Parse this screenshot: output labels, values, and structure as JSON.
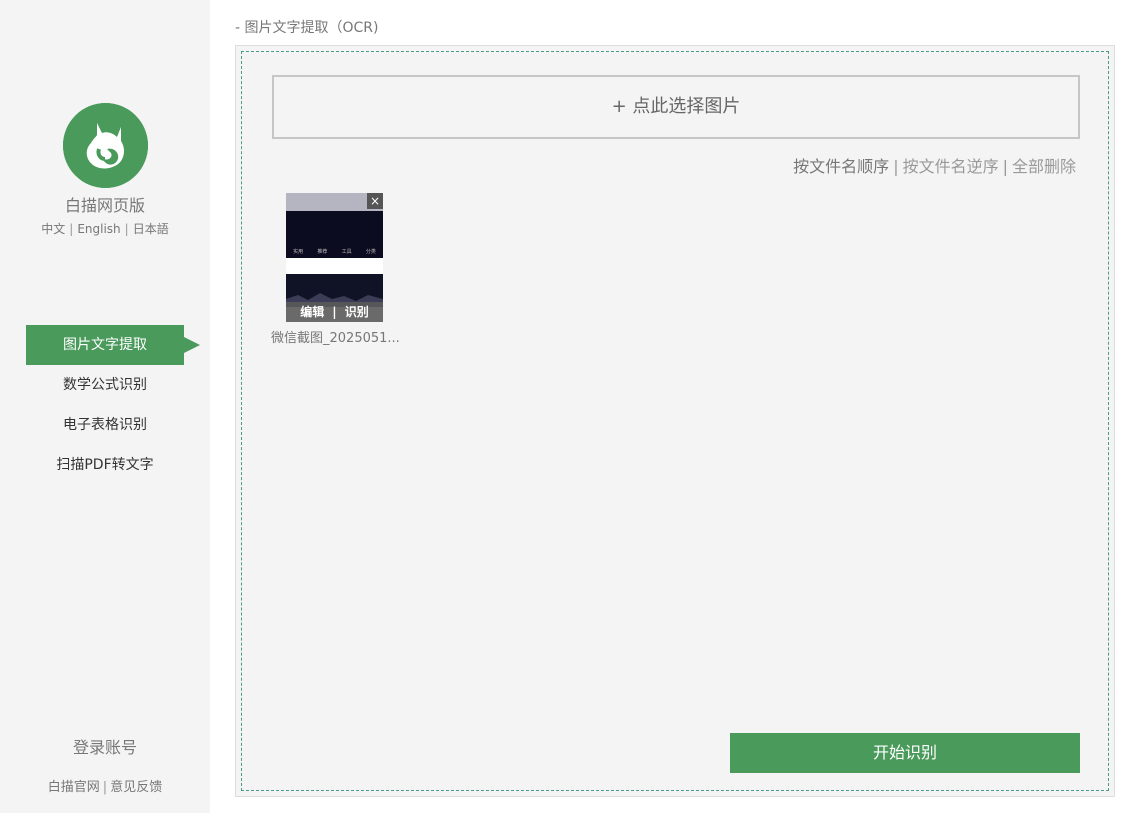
{
  "sidebar": {
    "app_name": "白描网页版",
    "languages": [
      "中文",
      "English",
      "日本語"
    ],
    "nav": [
      {
        "label": "图片文字提取",
        "active": true
      },
      {
        "label": "数学公式识别",
        "active": false
      },
      {
        "label": "电子表格识别",
        "active": false
      },
      {
        "label": "扫描PDF转文字",
        "active": false
      }
    ],
    "login_label": "登录账号",
    "footer_links": [
      "白描官网",
      "意见反馈"
    ]
  },
  "main": {
    "page_title": "- 图片文字提取（OCR)",
    "select_button": "+ 点此选择图片",
    "sort_links": [
      "按文件名顺序",
      "按文件名逆序",
      "全部删除"
    ],
    "files": [
      {
        "name": "微信截图_2025051...",
        "edit_label": "编辑",
        "recognize_label": "识别",
        "close_icon": "×",
        "preview_labels": [
          "实用",
          "推荐",
          "工具",
          "分类"
        ]
      }
    ],
    "start_button": "开始识别"
  },
  "colors": {
    "accent": "#4a9a5b",
    "sidebar_bg": "#f4f4f4",
    "panel_bg": "#f4f4f4",
    "dash_border": "#4a9a8a"
  },
  "icons": {
    "logo": "cat-logo-icon",
    "thumb_close": "close-icon"
  }
}
